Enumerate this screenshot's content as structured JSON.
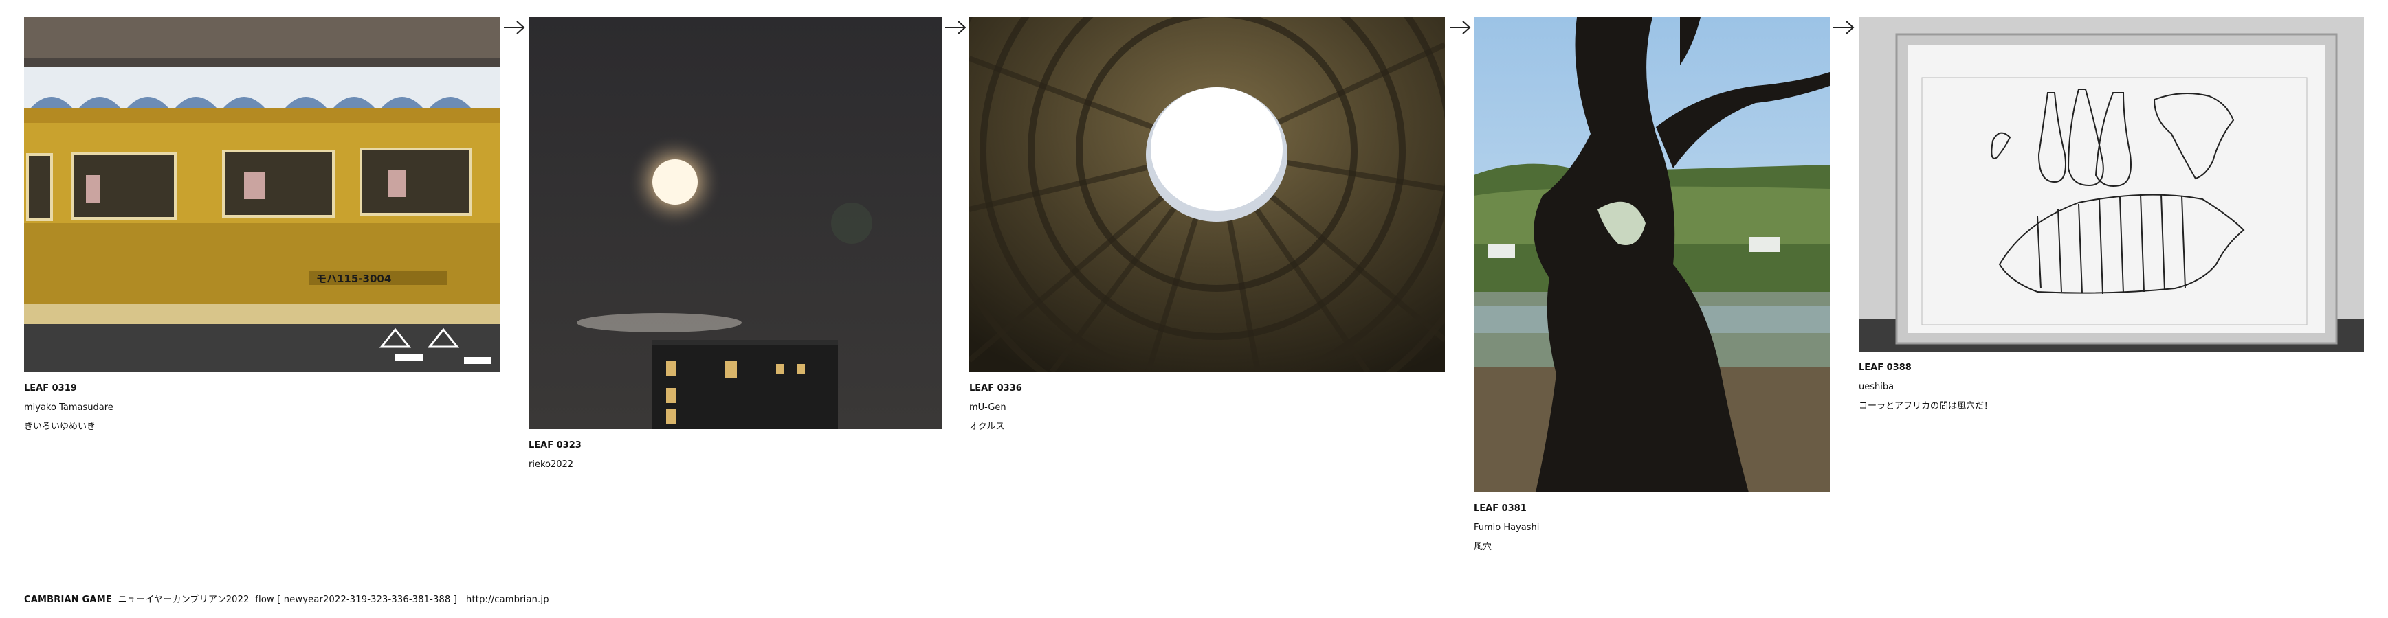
{
  "leaves": [
    {
      "code": "LEAF 0319",
      "author": "miyako Tamasudare",
      "title": "きいろいゆめいき",
      "train_number": "モハ115-3004"
    },
    {
      "code": "LEAF 0323",
      "author": "rieko2022",
      "title": ""
    },
    {
      "code": "LEAF 0336",
      "author": "mU-Gen",
      "title": "オクルス"
    },
    {
      "code": "LEAF 0381",
      "author": "Fumio Hayashi",
      "title": "風穴"
    },
    {
      "code": "LEAF 0388",
      "author": "ueshiba",
      "title": "コーラとアフリカの間は風穴だ！"
    }
  ],
  "arrow_glyph": "→",
  "footer": {
    "brand": "CAMBRIAN GAME",
    "project": "ニューイヤーカンブリアン2022",
    "flow": "flow [ newyear2022-319-323-336-381-388 ]",
    "url": "http://cambrian.jp"
  },
  "colors": {
    "train_yellow": "#c9a22e",
    "night_sky": "#2a2a2c",
    "dome": "#3a3320",
    "sky_blue": "#a9cbe6",
    "frame_silver": "#c9c9c9"
  }
}
